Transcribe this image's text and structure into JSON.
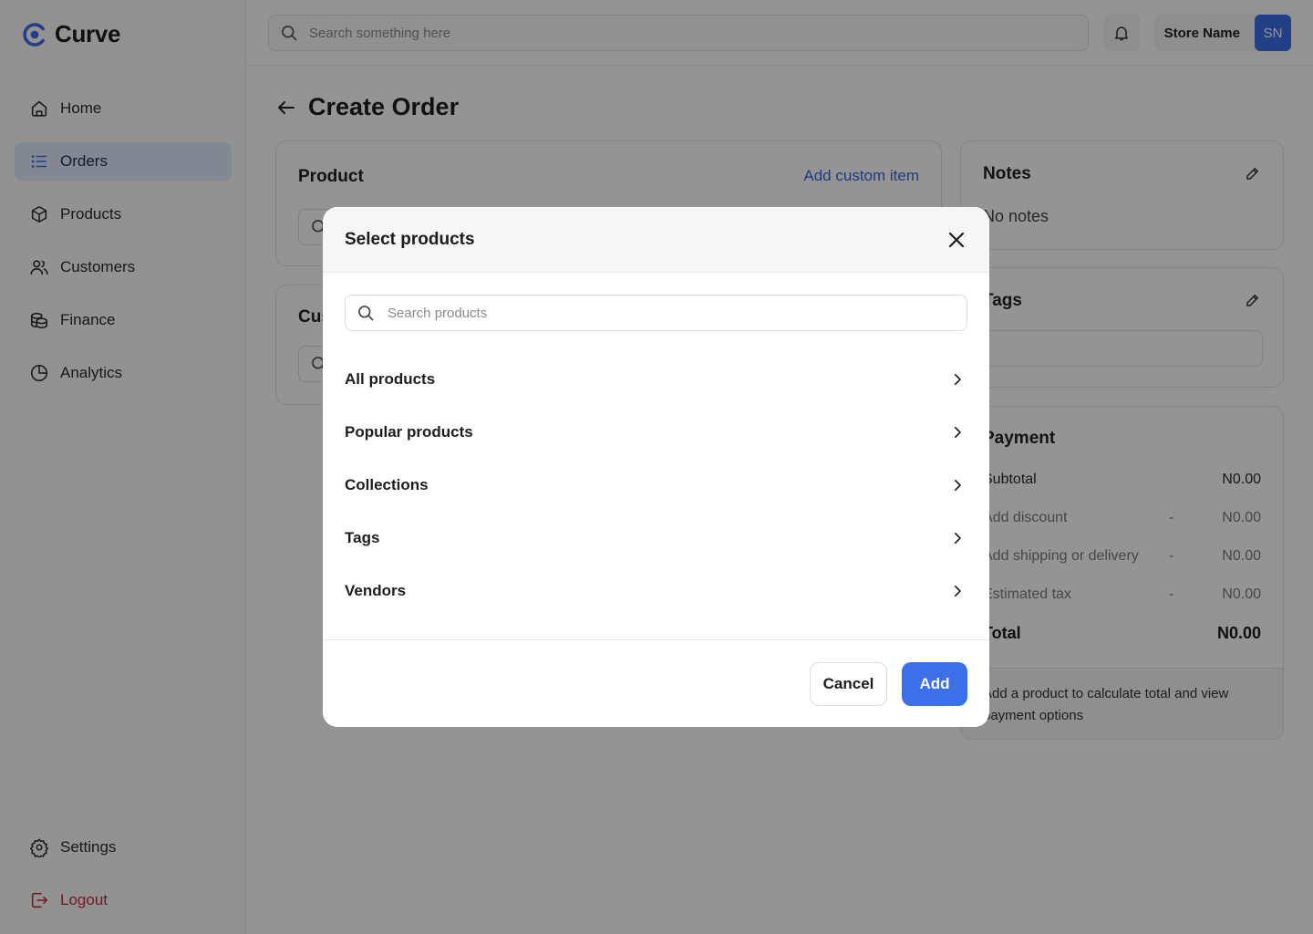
{
  "app": {
    "name": "Curve",
    "accent": "#3d6fe8",
    "danger": "#c8283e"
  },
  "sidebar": {
    "items": [
      {
        "label": "Home",
        "icon": "home-icon"
      },
      {
        "label": "Orders",
        "icon": "list-icon",
        "active": true
      },
      {
        "label": "Products",
        "icon": "box-icon"
      },
      {
        "label": "Customers",
        "icon": "users-icon"
      },
      {
        "label": "Finance",
        "icon": "coins-icon"
      },
      {
        "label": "Analytics",
        "icon": "pie-chart-icon"
      }
    ],
    "bottom": [
      {
        "label": "Settings",
        "icon": "gear-icon"
      },
      {
        "label": "Logout",
        "icon": "logout-icon"
      }
    ]
  },
  "topbar": {
    "search_placeholder": "Search something here",
    "store_name": "Store Name",
    "avatar_initials": "SN"
  },
  "page": {
    "title": "Create Order",
    "product_card": {
      "title": "Product",
      "action": "Add custom item"
    },
    "customer_card": {
      "title": "Customer"
    },
    "notes_card": {
      "title": "Notes",
      "value": "No notes"
    },
    "tags_card": {
      "title": "Tags"
    },
    "payment_card": {
      "title": "Payment",
      "subtotal_label": "Subtotal",
      "subtotal_value": "N0.00",
      "discount_label": "Add discount",
      "discount_dash": "-",
      "discount_value": "N0.00",
      "shipping_label": "Add shipping or delivery",
      "shipping_dash": "-",
      "shipping_value": "N0.00",
      "tax_label": "Estimated tax",
      "tax_dash": "-",
      "tax_value": "N0.00",
      "total_label": "Total",
      "total_value": "N0.00",
      "footer": "Add a product to calculate total and view payment options"
    }
  },
  "modal": {
    "title": "Select products",
    "search_placeholder": "Search products",
    "items": [
      "All products",
      "Popular products",
      "Collections",
      "Tags",
      "Vendors"
    ],
    "cancel_label": "Cancel",
    "add_label": "Add"
  }
}
